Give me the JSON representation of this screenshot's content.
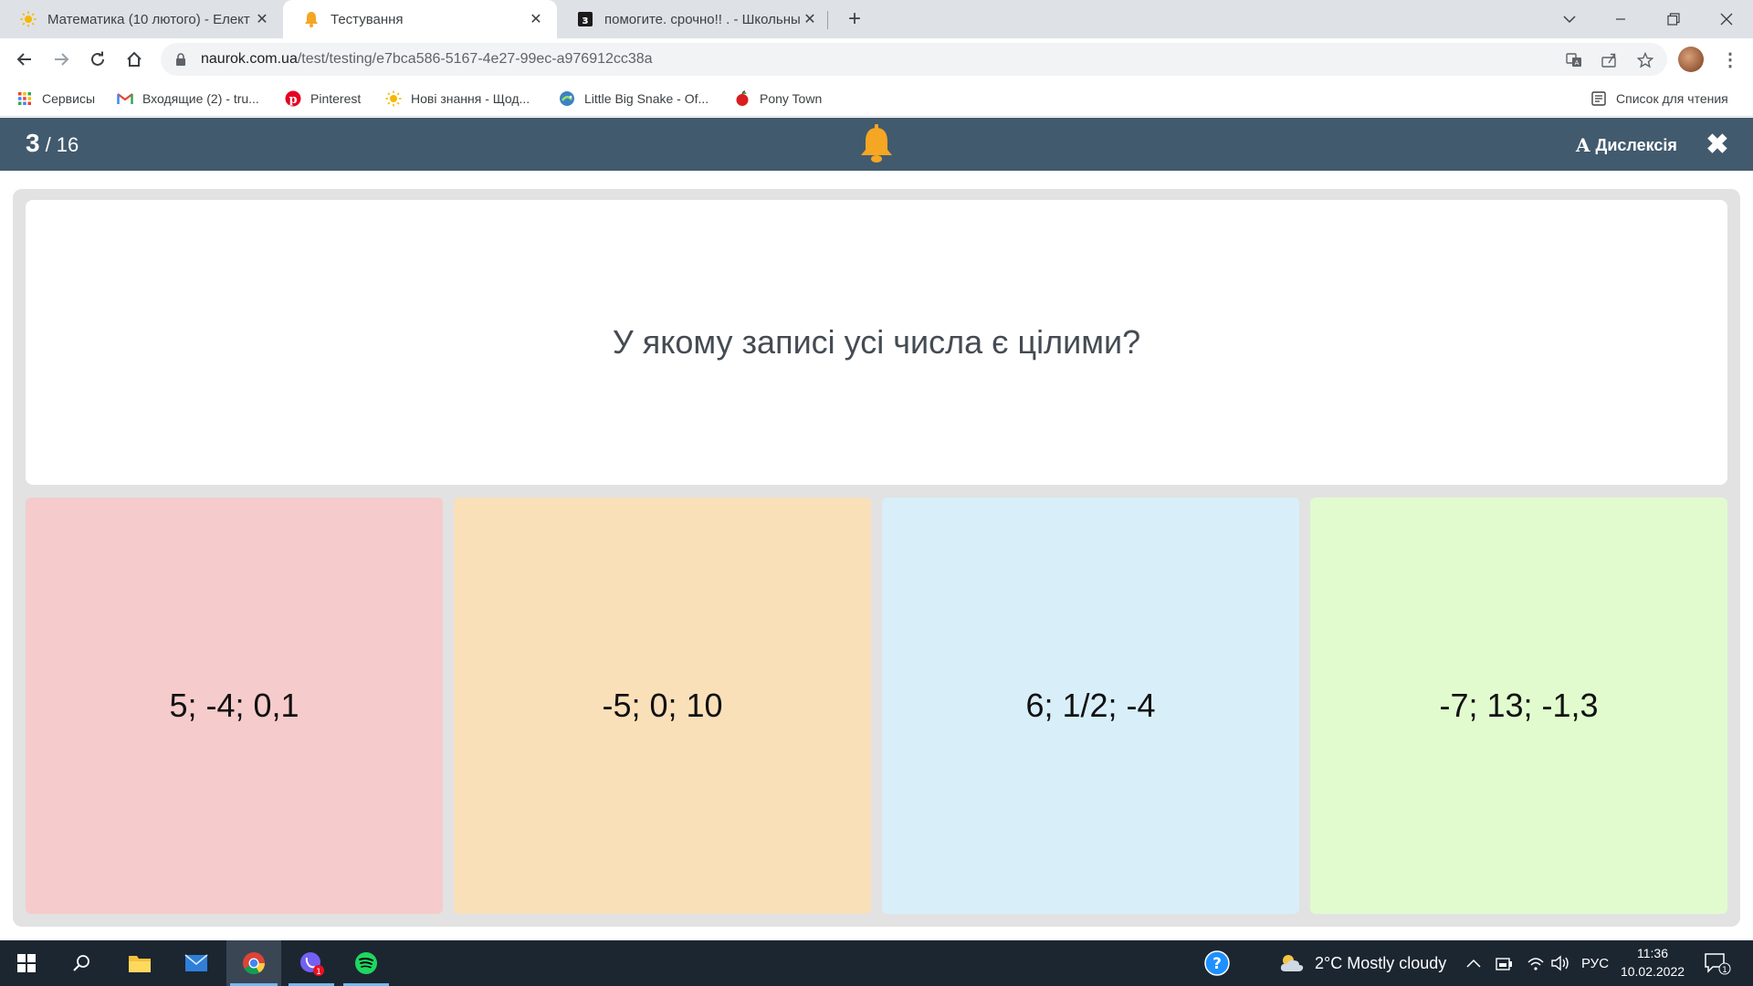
{
  "browser": {
    "tabs": [
      {
        "title": "Математика (10 лютого) - Елект",
        "active": false
      },
      {
        "title": "Тестування",
        "active": true
      },
      {
        "title": "помогите. срочно!! . - Школьны",
        "active": false
      }
    ],
    "url_host": "naurok.com.ua",
    "url_path": "/test/testing/e7bca586-5167-4e27-99ec-a976912cc38a",
    "bookmarks": [
      {
        "label": "Сервисы",
        "icon": "apps-grid-icon"
      },
      {
        "label": "Входящие (2) - tru...",
        "icon": "gmail-icon"
      },
      {
        "label": "Pinterest",
        "icon": "pinterest-icon"
      },
      {
        "label": "Нові знання - Щод...",
        "icon": "sun-icon"
      },
      {
        "label": "Little Big Snake - Of...",
        "icon": "snake-icon"
      },
      {
        "label": "Pony Town",
        "icon": "apple-icon"
      }
    ],
    "reading_list": "Список для чтения"
  },
  "app": {
    "current": "3",
    "separator": "/",
    "total": "16",
    "dyslexia_icon": "A",
    "dyslexia_label": "Дислексія",
    "close_symbol": "✖"
  },
  "question": {
    "text": "У якому записі усі числа є цілими?"
  },
  "answers": [
    {
      "text": "5; -4; 0,1",
      "color": "#f6cbcb"
    },
    {
      "text": "-5; 0; 10",
      "color": "#f9e0b9"
    },
    {
      "text": "6; 1/2; -4",
      "color": "#d8effa"
    },
    {
      "text": "-7; 13; -1,3",
      "color": "#e1fbcf"
    }
  ],
  "taskbar": {
    "viber_badge": "1",
    "weather": "2°C  Mostly cloudy",
    "language": "РУС",
    "time": "11:36",
    "date": "10.02.2022",
    "notifications": "1"
  }
}
